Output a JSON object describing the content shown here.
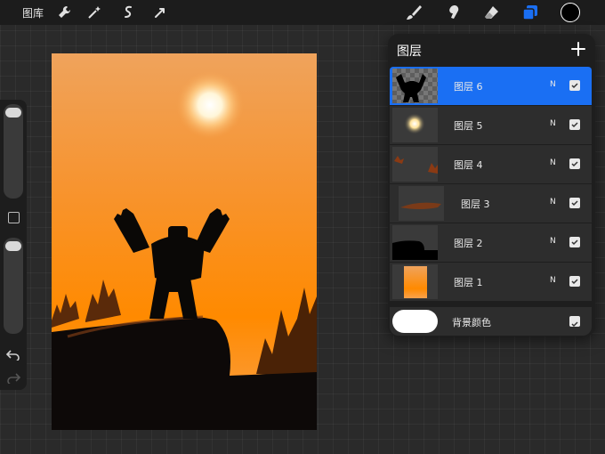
{
  "topbar": {
    "gallery_label": "图库",
    "left_tools": [
      "wrench-icon",
      "magic-wand-icon",
      "selection-icon",
      "transform-icon"
    ],
    "right_tools": [
      "brush-icon",
      "smudge-icon",
      "eraser-icon",
      "layers-icon"
    ],
    "active_tool": "layers-icon",
    "current_color": "#000000"
  },
  "layers_panel": {
    "title": "图层",
    "add_icon": "plus-icon",
    "layers": [
      {
        "name": "图层 6",
        "blend": "N",
        "visible": true,
        "active": true
      },
      {
        "name": "图层 5",
        "blend": "N",
        "visible": true,
        "active": false
      },
      {
        "name": "图层 4",
        "blend": "N",
        "visible": true,
        "active": false
      },
      {
        "name": "图层 3",
        "blend": "N",
        "visible": true,
        "active": false
      },
      {
        "name": "图层 2",
        "blend": "N",
        "visible": true,
        "active": false
      },
      {
        "name": "图层 1",
        "blend": "N",
        "visible": true,
        "active": false
      }
    ],
    "background": {
      "name": "背景颜色",
      "color": "#ffffff",
      "visible": true
    }
  },
  "colors": {
    "accent": "#1a6ff3",
    "sky_top": "#f0a65c",
    "sky_bottom": "#ff8c00"
  }
}
